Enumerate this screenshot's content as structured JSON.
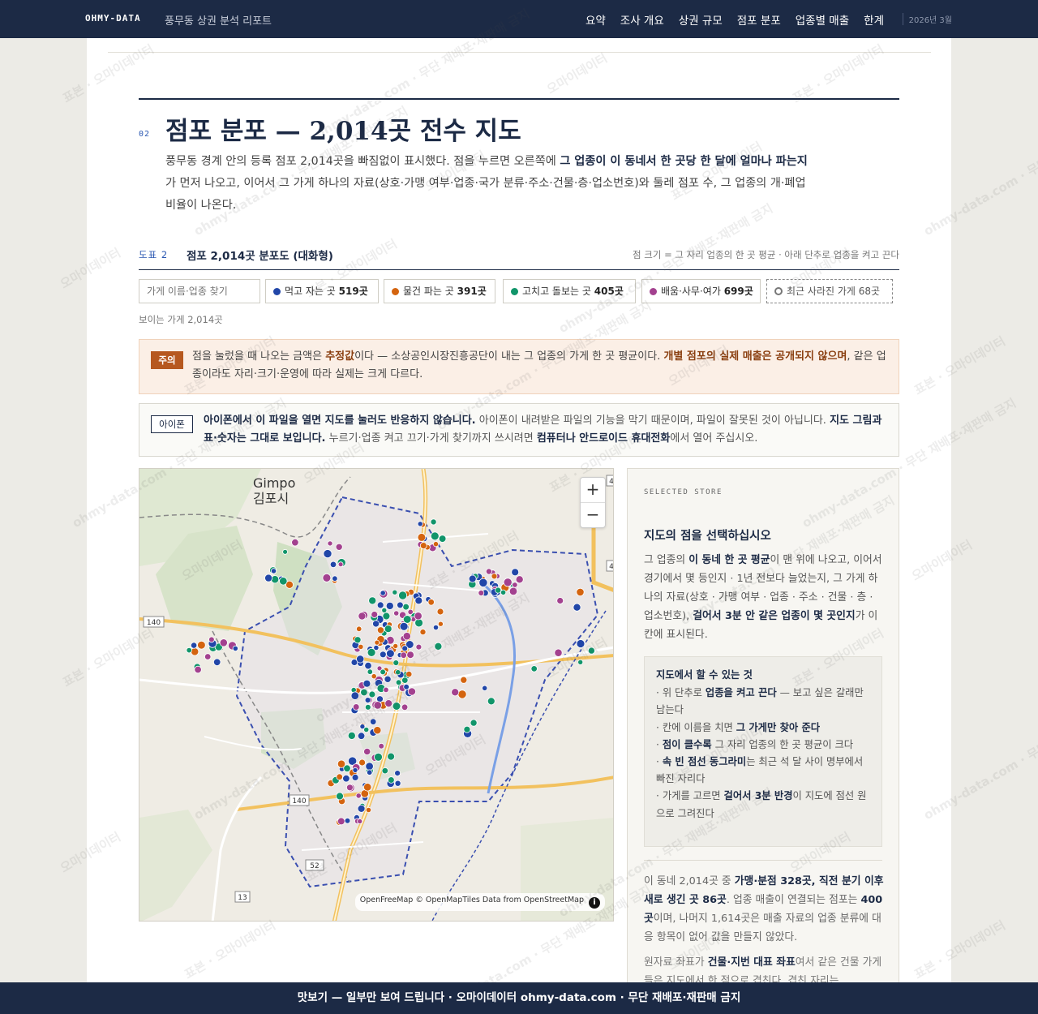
{
  "nav": {
    "brand": "OHMY-DATA",
    "doc_title": "풍무동 상권 분석 리포트",
    "links": [
      "요약",
      "조사 개요",
      "상권 규모",
      "점포 분포",
      "업종별 매출",
      "한계"
    ],
    "date": "2026년 3월"
  },
  "section": {
    "number": "02",
    "title": "점포 분포 — 2,014곳 전수 지도",
    "intro_1": "풍무동 경계 안의 등록 점포 2,014곳을 빠짐없이 표시했다. 점을 누르면 오른쪽에 ",
    "intro_bold": "그 업종이 이 동네서 한 곳당 한 달에 얼마나 파는지",
    "intro_2": "가 먼저 나오고, 이어서 그 가게 하나의 자료(상호·가맹 여부·업종·국가 분류·주소·건물·층·업소번호)와 둘레 점포 수, 그 업종의 개·폐업 비율이 나온다."
  },
  "figure": {
    "label": "도표 2",
    "title": "점포 2,014곳 분포도 (대화형)",
    "note": "점 크기 = 그 자리 업종의 한 곳 평균 · 아래 단추로 업종을 켜고 끈다"
  },
  "filters": {
    "search_placeholder": "가게 이름·업종 찾기",
    "chips": [
      {
        "label": "먹고 자는 곳",
        "count": "519곳",
        "color": "#2146a8"
      },
      {
        "label": "물건 파는 곳",
        "count": "391곳",
        "color": "#d4640f"
      },
      {
        "label": "고치고 돌보는 곳",
        "count": "405곳",
        "color": "#11956a"
      },
      {
        "label": "배움·사무·여가",
        "count": "699곳",
        "color": "#a3418f"
      },
      {
        "label": "최근 사라진 가게",
        "count": "68곳",
        "color": "#777777"
      }
    ],
    "visible_count": "보이는 가게 2,014곳"
  },
  "warning": {
    "badge": "주의",
    "t1": "점을 눌렀을 때 나오는 금액은 ",
    "t2": "추정값",
    "t3": "이다 — 소상공인시장진흥공단이 내는 그 업종의 가게 한 곳 평균이다. ",
    "t4": "개별 점포의 실제 매출은 공개되지 않으며",
    "t5": ", 같은 업종이라도 자리·크기·운영에 따라 실제는 크게 다르다."
  },
  "iphone": {
    "badge": "아이폰",
    "t1": "아이폰에서 이 파일을 열면 지도를 눌러도 반응하지 않습니다.",
    "t2": " 아이폰이 내려받은 파일의 기능을 막기 때문이며, 파일이 잘못된 것이 아닙니다. ",
    "t3": "지도 그림과 표·숫자는 그대로 보입니다.",
    "t4": " 누르기·업종 켜고 끄기·가게 찾기까지 쓰시려면 ",
    "t5": "컴퓨터나 안드로이드 휴대전화",
    "t6": "에서 열어 주십시오."
  },
  "map": {
    "place_en": "Gimpo",
    "place_ko": "김포시",
    "attribution": "OpenFreeMap © OpenMapTiles Data from OpenStreetMap",
    "road_labels": [
      "140",
      "140",
      "52",
      "13",
      "4",
      "4"
    ],
    "zoom_in": "+",
    "zoom_out": "−",
    "info_icon": "i"
  },
  "side": {
    "kicker": "SELECTED STORE",
    "title": "지도의 점을 선택하십시오",
    "d1": "그 업종의 ",
    "d2": "이 동네 한 곳 평균",
    "d3": "이 맨 위에 나오고, 이어서 경기에서 몇 등인지 · 1년 전보다 늘었는지, 그 가게 하나의 자료(상호 · 가맹 여부 · 업종 · 주소 · 건물 · 층 · 업소번호), ",
    "d4": "걸어서 3분 안 같은 업종이 몇 곳인지",
    "d5": "가 이 칸에 표시된다.",
    "howto_title": "지도에서 할 수 있는 것",
    "howto": [
      {
        "a": "· 위 단추로 ",
        "b": "업종을 켜고 끈다",
        "c": " — 보고 싶은 갈래만 남는다"
      },
      {
        "a": "· 칸에 이름을 치면 ",
        "b": "그 가게만 찾아 준다",
        "c": ""
      },
      {
        "a": "· ",
        "b": "점이 클수록",
        "c": " 그 자리 업종의 한 곳 평균이 크다"
      },
      {
        "a": "· ",
        "b": "속 빈 점선 동그라미",
        "c": "는 최근 석 달 사이 명부에서 빠진 자리다"
      },
      {
        "a": "· 가게를 고르면 ",
        "b": "걸어서 3분 반경",
        "c": "이 지도에 점선 원으로 그려진다"
      }
    ],
    "s1": "이 동네 2,014곳 중 ",
    "s2": "가맹·분점 328곳, 직전 분기 이후 새로 생긴 곳 86곳",
    "s3": ". 업종 매출이 연결되는 점포는 ",
    "s4": "400곳",
    "s5": "이며, 나머지 1,614곳은 매출 자료의 업종 분류에 대응 항목이 없어 값을 만들지 않았다.",
    "n1": "원자료 좌표가 ",
    "n2": "건물·지번 대표 좌표",
    "n3": "여서 같은 건물 가게들은 지도에서 한 점으로 겹친다. 겹친 자리는"
  },
  "footer": "맛보기 — 일부만 보여 드립니다 · 오마이데이터 ohmy-data.com · 무단 재배포·재판매 금지",
  "watermarks": [
    "표본 · 오마이데이터",
    "ohmy-data.com · 무단 재배포·재판매 금지",
    "오마이데이터"
  ]
}
